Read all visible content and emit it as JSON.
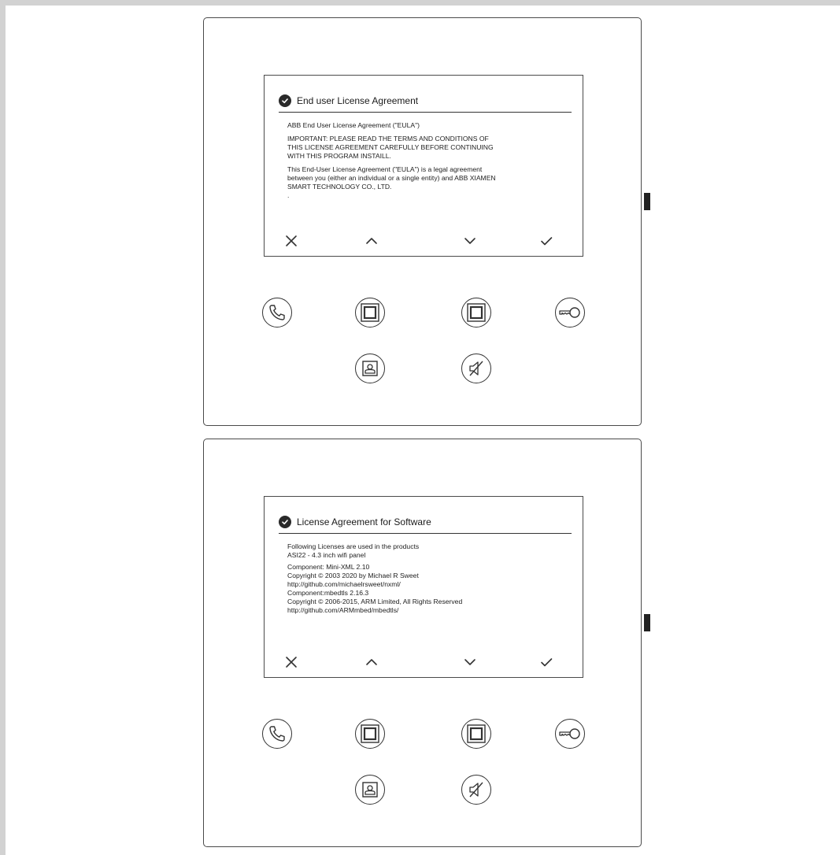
{
  "panels": [
    {
      "title": "End user License Agreement",
      "lines": [
        [
          "ABB End User License Agreement (\"EULA\")"
        ],
        [
          "IMPORTANT: PLEASE READ THE TERMS AND CONDITIONS OF",
          "THIS LICENSE AGREEMENT CAREFULLY BEFORE CONTINUING",
          "WITH THIS PROGRAM INSTAILL."
        ],
        [
          "This End-User License Agreement (\"EULA\") is a legal agreement",
          "between you (either an individual or a single entity) and ABB XIAMEN",
          "SMART TECHNOLOGY CO., LTD.",
          "."
        ]
      ]
    },
    {
      "title": "License Agreement for Software",
      "lines": [
        [
          "Following Licenses are used in the products",
          "ASI22 - 4.3 inch wifi panel"
        ],
        [
          "Component: Mini-XML 2.10",
          "Copyright © 2003  2020  by Michael R Sweet",
          "http://github.com/michaelrsweet/nxml/",
          "Component:mbedtls 2.16.3",
          "Copyright © 2006-2015, ARM Limited, All Rights Reserved",
          "http://github.com/ARMmbed/mbedtls/"
        ]
      ]
    }
  ],
  "nav_icons": [
    "close-icon",
    "chevron-up-icon",
    "chevron-down-icon",
    "check-icon"
  ],
  "hardware_icons": [
    "phone-icon",
    "square-icon",
    "square-icon",
    "key-icon",
    "monitor-icon",
    "mute-icon"
  ]
}
